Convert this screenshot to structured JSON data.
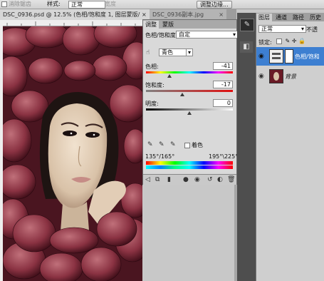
{
  "options_bar": {
    "anti_alias_label": "消除锯齿",
    "style_label": "样式:",
    "style_value": "正常",
    "width_label": "宽度",
    "refine_edge_label": "调整边缘..."
  },
  "doc_tabs": [
    {
      "title": "DSC_0936.psd @ 12.5% (色相/饱和度 1, 图层蒙版/8) *",
      "close": "×"
    },
    {
      "title": "DSC_0936副本.jpg",
      "close": "×"
    }
  ],
  "adjustments": {
    "tabs": [
      "调整",
      "蒙版"
    ],
    "panel_title": "色相/饱和度",
    "preset_value": "自定",
    "channel_value": "青色",
    "hue_label": "色相:",
    "hue_value": "-41",
    "saturation_label": "饱和度:",
    "saturation_value": "-17",
    "lightness_label": "明度:",
    "lightness_value": "0",
    "colorize_label": "着色",
    "range_left": "135°/165°",
    "range_right": "195°\\225°",
    "slider_fractions": {
      "hue": 0.27,
      "saturation": 0.42,
      "lightness": 0.5
    }
  },
  "layers_panel": {
    "tabs": [
      "图层",
      "通道",
      "路径",
      "历史"
    ],
    "blend_mode": "正常",
    "opacity_label": "不透",
    "lock_label": "锁定:",
    "layers": [
      {
        "name": "色相/饱和",
        "selected": true
      },
      {
        "name": "背景",
        "selected": false
      }
    ]
  },
  "colors": {
    "selected_layer": "#3d7fd1",
    "panel_bg": "#d9d9d9"
  }
}
